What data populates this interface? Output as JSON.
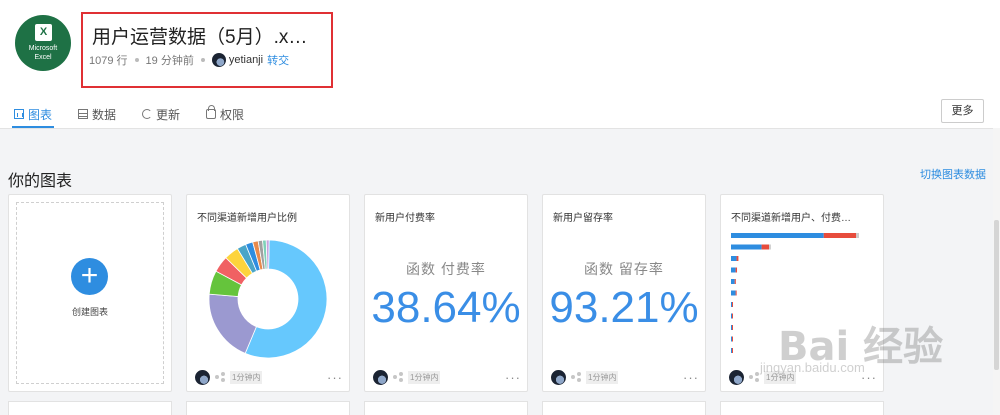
{
  "file": {
    "title": "用户运营数据（5月）.x…",
    "rows": "1079 行",
    "updated": "19 分钟前",
    "owner": "yetianji",
    "transfer": "转交",
    "logo_text": "Microsoft Excel",
    "logo_line1": "Microsoft",
    "logo_line2": "Excel",
    "logo_letter": "X",
    "logo_color": "#1e7145"
  },
  "tabs": [
    {
      "label": "图表",
      "icon": "chart-icon",
      "active": true
    },
    {
      "label": "数据",
      "icon": "table-icon"
    },
    {
      "label": "更新",
      "icon": "refresh-icon"
    },
    {
      "label": "权限",
      "icon": "lock-icon"
    }
  ],
  "more_button": "更多",
  "section": {
    "title": "你的图表",
    "switch_link": "切换图表数据"
  },
  "create_card": {
    "label": "创建图表",
    "plus": "+"
  },
  "cards": [
    {
      "title": "不同渠道新增用户比例",
      "type": "donut",
      "time": "1分钟内",
      "dots": "···"
    },
    {
      "title": "新用户付费率",
      "function_label": "函数 付费率",
      "value": "38.64%",
      "time": "1分钟内",
      "dots": "···"
    },
    {
      "title": "新用户留存率",
      "function_label": "函数 留存率",
      "value": "93.21%",
      "time": "1分钟内",
      "dots": "···"
    },
    {
      "title": "不同渠道新增用户、付费…",
      "type": "bar",
      "time": "1分钟内",
      "dots": "···"
    }
  ],
  "accent_color": "#2e8de0",
  "chart_data": [
    {
      "type": "pie",
      "title": "不同渠道新增用户比例",
      "slices": [
        {
          "value": 56,
          "color": "#66c8fd"
        },
        {
          "value": 20,
          "color": "#9b99d0"
        },
        {
          "value": 6.5,
          "color": "#65c43c"
        },
        {
          "value": 4.5,
          "color": "#f06163"
        },
        {
          "value": 4,
          "color": "#fdd43c"
        },
        {
          "value": 2.5,
          "color": "#4aa5c8"
        },
        {
          "value": 2,
          "color": "#2e8de0"
        },
        {
          "value": 1.5,
          "color": "#e88a4d"
        },
        {
          "value": 1.2,
          "color": "#a0a0a0"
        },
        {
          "value": 1,
          "color": "#7fd1b9"
        },
        {
          "value": 0.8,
          "color": "#c5a3e0"
        }
      ]
    },
    {
      "type": "bar",
      "title": "不同渠道新增用户、付费…",
      "orientation": "horizontal",
      "stacked": true,
      "series": [
        {
          "color": "#2e8de0",
          "values": [
            100,
            33,
            6,
            5,
            4,
            5,
            1,
            0.6,
            0.5,
            0.4,
            0.3
          ]
        },
        {
          "color": "#e74c3c",
          "values": [
            35,
            8,
            2,
            1.5,
            1.2,
            1,
            0.3,
            0.2,
            0.2,
            0.1,
            0.1
          ]
        },
        {
          "color": "#cccccc",
          "values": [
            3,
            2,
            0,
            0,
            0,
            0,
            0,
            0,
            0,
            0,
            0
          ]
        }
      ]
    }
  ],
  "watermark": {
    "text": "Bai  经验",
    "sub": "jingyan.baidu.com"
  }
}
